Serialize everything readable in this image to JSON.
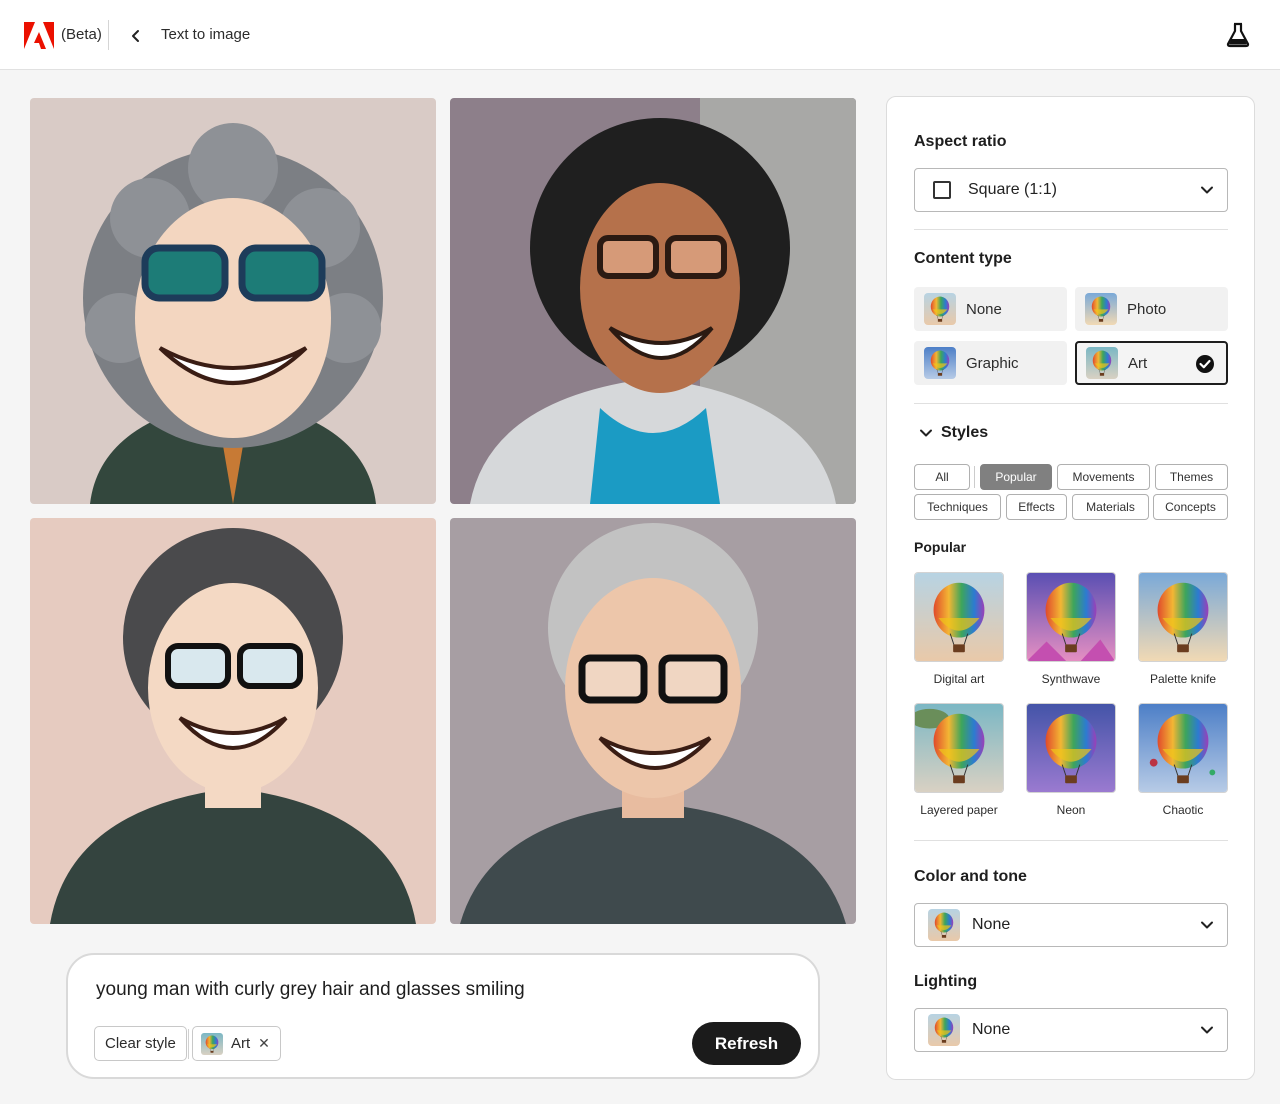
{
  "header": {
    "brand_icon": "adobe-logo",
    "beta_label": "(Beta)",
    "back_icon": "chevron-left-icon",
    "breadcrumb": "Text to image",
    "labs_icon": "flask-icon"
  },
  "results": {
    "images": [
      {
        "name": "generated-image-1",
        "description_icon": "portrait-image"
      },
      {
        "name": "generated-image-2",
        "description_icon": "portrait-image"
      },
      {
        "name": "generated-image-3",
        "description_icon": "portrait-image"
      },
      {
        "name": "generated-image-4",
        "description_icon": "portrait-image"
      }
    ]
  },
  "prompt": {
    "text": "young man with curly grey hair and glasses smiling",
    "clear_style_label": "Clear style",
    "applied_style_label": "Art",
    "remove_icon": "close-icon",
    "refresh_label": "Refresh"
  },
  "panel": {
    "aspect_ratio": {
      "heading": "Aspect ratio",
      "value": "Square (1:1)"
    },
    "content_type": {
      "heading": "Content type",
      "options": [
        {
          "label": "None",
          "selected": false
        },
        {
          "label": "Photo",
          "selected": false
        },
        {
          "label": "Graphic",
          "selected": false
        },
        {
          "label": "Art",
          "selected": true
        }
      ]
    },
    "styles": {
      "heading": "Styles",
      "filters": [
        {
          "label": "All",
          "active": false
        },
        {
          "label": "Popular",
          "active": true
        },
        {
          "label": "Movements",
          "active": false
        },
        {
          "label": "Themes",
          "active": false
        },
        {
          "label": "Techniques",
          "active": false
        },
        {
          "label": "Effects",
          "active": false
        },
        {
          "label": "Materials",
          "active": false
        },
        {
          "label": "Concepts",
          "active": false
        }
      ],
      "section_heading": "Popular",
      "items": [
        {
          "label": "Digital art"
        },
        {
          "label": "Synthwave"
        },
        {
          "label": "Palette knife"
        },
        {
          "label": "Layered paper"
        },
        {
          "label": "Neon"
        },
        {
          "label": "Chaotic"
        }
      ]
    },
    "color_and_tone": {
      "heading": "Color and tone",
      "value": "None"
    },
    "lighting": {
      "heading": "Lighting",
      "value": "None"
    }
  },
  "colors": {
    "brand_red": "#eb1000",
    "refresh_bg": "#1b1b1b",
    "active_filter_bg": "#808080"
  }
}
